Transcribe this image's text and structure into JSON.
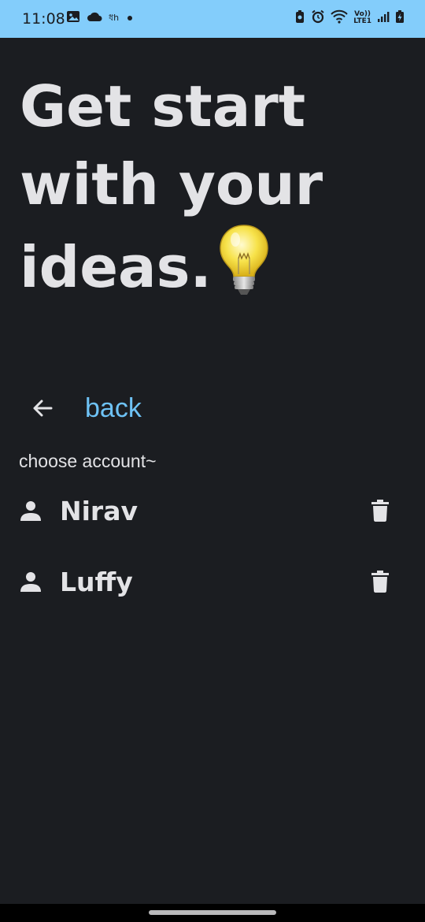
{
  "status_bar": {
    "time": "11:08",
    "left_icons": [
      "gallery-icon",
      "cloud-icon",
      "app-icon",
      "dot-icon"
    ],
    "app_text": "ধh",
    "network_label_top": "Vo))",
    "network_label_bottom": "LTE1",
    "right_icons": [
      "battery-saver-icon",
      "alarm-icon",
      "wifi-icon",
      "signal-icon",
      "battery-charging-icon"
    ],
    "background_color": "#83cdfb"
  },
  "header": {
    "line1": "Get start",
    "line2": "with your",
    "line3": "ideas.",
    "emoji_icon": "lightbulb-icon"
  },
  "back": {
    "label": "back",
    "icon": "arrow-left-icon",
    "color": "#6ec2f5"
  },
  "choose_account": {
    "label": "choose account~"
  },
  "accounts": [
    {
      "name": "Nirav",
      "icon": "person-icon",
      "action_icon": "trash-icon"
    },
    {
      "name": "Luffy",
      "icon": "person-icon",
      "action_icon": "trash-icon"
    }
  ],
  "theme": {
    "background": "#1b1d21",
    "text": "#e3e3e6"
  }
}
